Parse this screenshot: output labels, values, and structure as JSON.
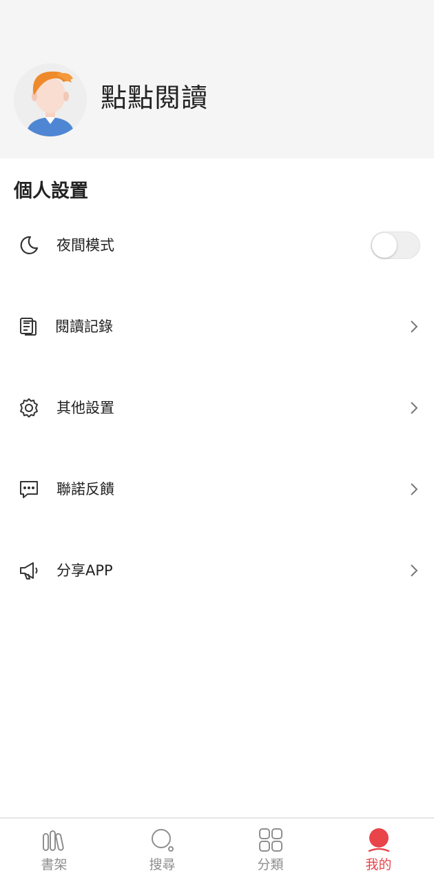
{
  "header": {
    "app_name": "點點閱讀"
  },
  "settings": {
    "section_title": "個人設置",
    "night_mode": {
      "label": "夜間模式",
      "enabled": false
    },
    "items": [
      {
        "label": "閱讀記錄",
        "icon": "reading-history-icon"
      },
      {
        "label": "其他設置",
        "icon": "gear-icon"
      },
      {
        "label": "聯諾反饋",
        "icon": "feedback-icon"
      },
      {
        "label": "分享APP",
        "icon": "megaphone-icon"
      }
    ]
  },
  "tabbar": {
    "tabs": [
      {
        "label": "書架",
        "icon": "bookshelf-icon",
        "active": false
      },
      {
        "label": "搜尋",
        "icon": "search-icon",
        "active": false
      },
      {
        "label": "分類",
        "icon": "category-grid-icon",
        "active": false
      },
      {
        "label": "我的",
        "icon": "profile-icon",
        "active": true
      }
    ]
  },
  "colors": {
    "accent": "#e8444a",
    "inactive_tab": "#8e8e8e",
    "header_bg": "#f5f5f5",
    "avatar_hair": "#ef8a2c",
    "avatar_shirt": "#4f86d3"
  }
}
